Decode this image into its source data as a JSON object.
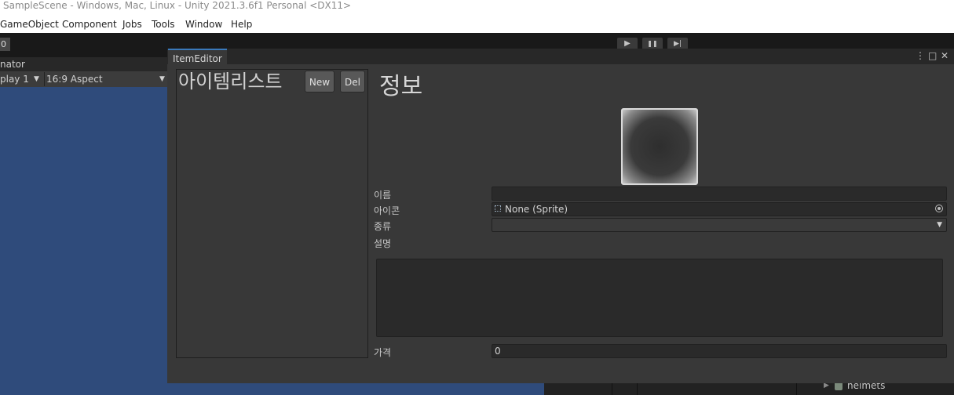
{
  "window_title": "SampleScene - Windows, Mac, Linux - Unity 2021.3.6f1 Personal <DX11>",
  "menu": [
    "GameObject",
    "Component",
    "Jobs",
    "Tools",
    "Window",
    "Help"
  ],
  "toolbar": {
    "left_chip": "0",
    "play": "▶",
    "pause": "❚❚",
    "step": "▶|"
  },
  "game_view": {
    "tab": "nator",
    "display": "play 1",
    "aspect": "16:9 Aspect"
  },
  "item_editor": {
    "tab": "ItemEditor",
    "controls": {
      "menu": "⋮",
      "maximize": "□",
      "close": "✕"
    },
    "list": {
      "title": "아이템리스트",
      "new_label": "New",
      "del_label": "Del"
    },
    "info": {
      "title": "정보",
      "name_label": "이름",
      "name_value": "",
      "icon_label": "아이콘",
      "icon_value": "None (Sprite)",
      "type_label": "종류",
      "type_value": "",
      "desc_label": "설명",
      "desc_value": "",
      "price_label": "가격",
      "price_value": "0"
    }
  },
  "hierarchy": {
    "visible_item": "helmets"
  }
}
